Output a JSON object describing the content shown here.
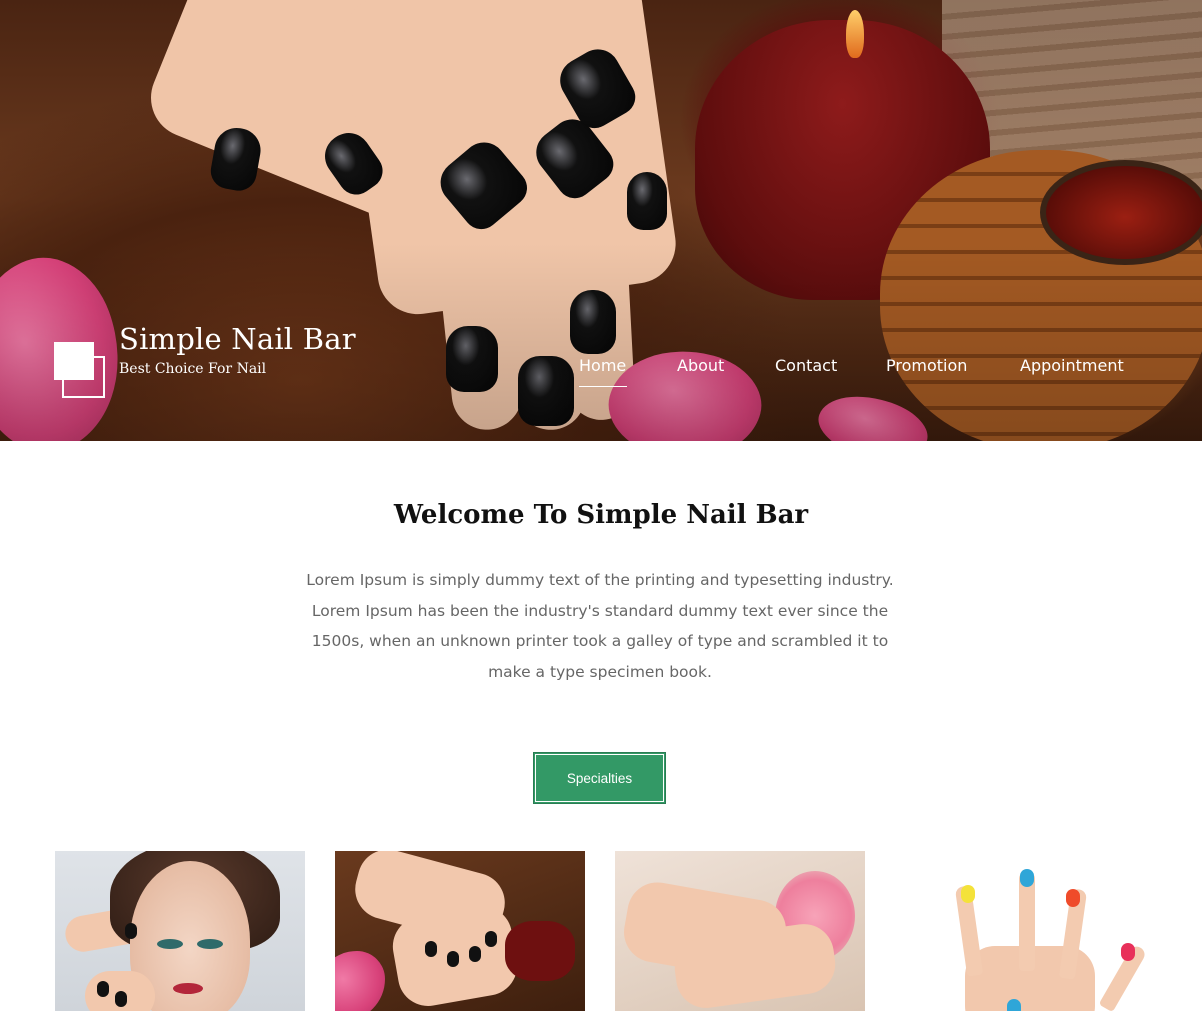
{
  "site": {
    "title": "Simple Nail Bar",
    "tagline": "Best Choice For Nail"
  },
  "nav": {
    "items": [
      {
        "label": "Home",
        "active": true
      },
      {
        "label": "About",
        "active": false
      },
      {
        "label": "Contact",
        "active": false
      },
      {
        "label": "Promotion",
        "active": false
      },
      {
        "label": "Appointment",
        "active": false
      }
    ]
  },
  "welcome": {
    "title": "Welcome To Simple Nail Bar",
    "body_lines": [
      "Lorem Ipsum is simply dummy text of the printing and typesetting industry.",
      "Lorem Ipsum has been the industry's standard dummy text ever since the",
      "1500s, when an unknown printer took a galley of type and scrambled it to",
      "make a type specimen book."
    ]
  },
  "cta": {
    "label": "Specialties"
  },
  "colors": {
    "accent": "#339966",
    "text_muted": "#666666",
    "heading": "#111111"
  }
}
